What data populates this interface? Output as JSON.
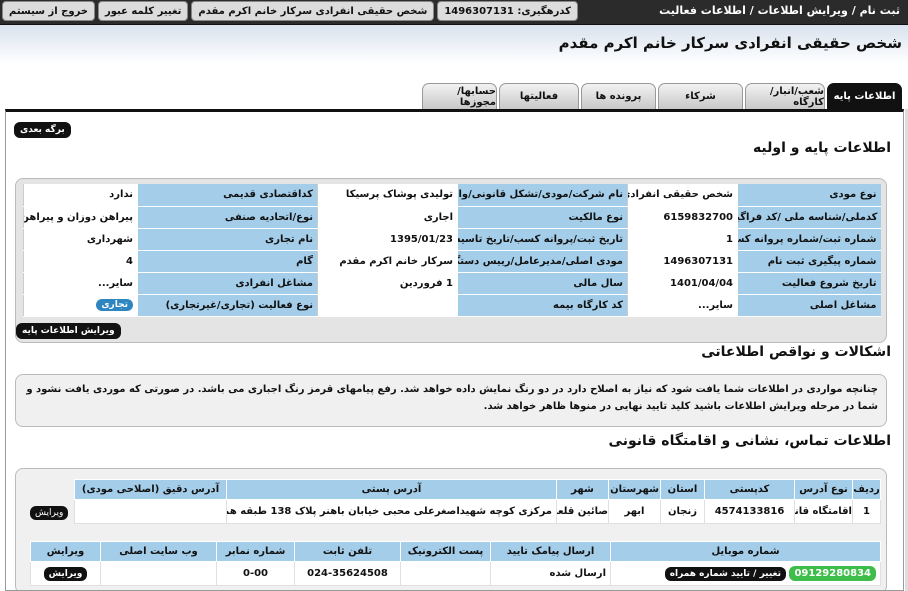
{
  "breadcrumb": "ثبت نام / ویرایش اطلاعات / اطلاعات فعالیت",
  "topbar": {
    "code_label": "کدرهگیری:",
    "code_value": "1496307131",
    "user_title": "شخص حقیقی انفرادی سرکار خانم اکرم مقدم",
    "change_password": "تغییر کلمه عبور",
    "exit": "خروج از سیستم"
  },
  "page_title": "شخص حقیقی انفرادی سرکار خانم اکرم مقدم",
  "tabs": [
    "اطلاعات پایه",
    "شعب/انبار/کارگاه",
    "شرکاء",
    "پرونده ها",
    "فعالیتها",
    "حسابها/مجوزها"
  ],
  "next_button": "برگه بعدی",
  "basic_section_title": "اطلاعات پایه و اولیه",
  "info_rows": [
    [
      [
        "نوع مودی",
        "شخص حقیقی انفرادی"
      ],
      [
        "نام شرکت/مودی/تشکل قانونی/واحد صنفی",
        "تولیدی پوشاک پرسیکا"
      ],
      [
        "کداقتصادی قدیمی",
        "ندارد"
      ]
    ],
    [
      [
        "کدملی/شناسه ملی /کد فراگیر",
        "6159832700"
      ],
      [
        "نوع مالکیت",
        "اجاری"
      ],
      [
        "نوع/اتحادیه صنفی",
        "پیراهن دوزان و پیراهن فروشان"
      ]
    ],
    [
      [
        "شماره ثبت/شماره پروانه کسب",
        "1"
      ],
      [
        "تاریخ ثبت/پروانه کسب/تاریخ تاسیس",
        "1395/01/23"
      ],
      [
        "نام تجاری",
        "شهرداری"
      ]
    ],
    [
      [
        "شماره پیگیری ثبت نام",
        "1496307131"
      ],
      [
        "مودی اصلی/مدیرعامل/رییس دستگاه",
        "سرکار خانم اکرم مقدم"
      ],
      [
        "گام",
        "4"
      ]
    ],
    [
      [
        "تاریخ شروع فعالیت",
        "1401/04/04"
      ],
      [
        "سال مالی",
        "1 فروردین"
      ],
      [
        "مشاغل انفرادی",
        "سایر..."
      ]
    ],
    [
      [
        "مشاغل اصلی",
        "سایر..."
      ],
      [
        "کد کارگاه بیمه",
        ""
      ],
      [
        "نوع فعالیت (تجاری/غیرتجاری)",
        "تجاری"
      ]
    ]
  ],
  "edit_basic_button": "ویرایش اطلاعات پایه",
  "issues_title": "اشکالات و نواقص اطلاعاتی",
  "issues_text": "چنانچه مواردی در اطلاعات شما یافت شود که نیاز به اصلاح دارد در دو رنگ نمایش داده خواهد شد. رفع پیامهای قرمز رنگ اجباری می باشد. در صورتی که موردی یافت نشود و شما در مرحله ویرایش اطلاعات باشید کلید تایید نهایی در منوها ظاهر خواهد شد.",
  "address_title": "اطلاعات تماس، نشانی و اقامتگاه قانونی",
  "address_table": {
    "headers": [
      "ردیف",
      "نوع آدرس",
      "کدپستی",
      "استان",
      "شهرستان",
      "شهر",
      "آدرس پستی",
      "آدرس دقیق (اصلاحی مودی)"
    ],
    "row": [
      "1",
      "اقامتگاه قانونی",
      "4574133816",
      "زنجان",
      "ابهر",
      "صائین قلعه",
      "مرکزی کوچه شهیداصغرعلی محبی خیابان باهنر پلاک 138 طبقه همکف",
      ""
    ],
    "edit": "ویرایش"
  },
  "contact_table": {
    "headers": [
      "شماره موبایل",
      "ارسال پیامک تایید",
      "پست الکترونیک",
      "تلفن ثابت",
      "شماره نمابر",
      "وب سایت اصلی",
      "ویرایش"
    ],
    "mobile": "09129280834",
    "mobile_action": "تغییر / تایید شماره همراه",
    "sms": "ارسال شده",
    "email": "",
    "phone": "024-35624508",
    "fax": "0-00",
    "website": "",
    "edit": "ویرایش"
  }
}
